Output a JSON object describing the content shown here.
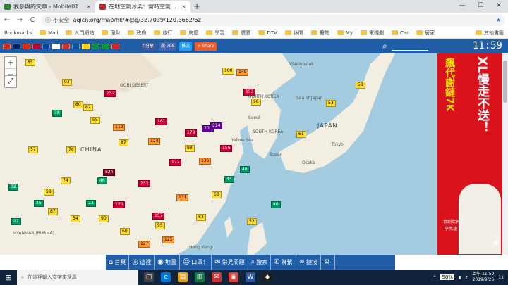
{
  "browser": {
    "tabs": [
      {
        "title": "我參與的文章 - Mobile01",
        "close": "×",
        "favicon_color": "#2e7d32"
      },
      {
        "title": "在地空氣污染：實時空氣質量指數",
        "close": "×",
        "favicon_color": "#c62828"
      }
    ],
    "new_tab": "+",
    "window_controls": [
      "—",
      "☐",
      "✕"
    ],
    "nav": {
      "back": "←",
      "forward": "→",
      "reload": "C"
    },
    "address": {
      "security": "ⓘ 不安全",
      "url": "aqicn.org/map/hk/#@g/32.7039/120.3662/5z",
      "star": "★"
    },
    "bookmarks": [
      "Bookmarks",
      "Mail",
      "入門網站",
      "理財",
      "政府",
      "旅行",
      "房屋",
      "學習",
      "寶寶",
      "DTV",
      "休閒",
      "醫院",
      "My",
      "電視劇",
      "Car",
      "居家"
    ],
    "other_bookmarks": "其他書籤"
  },
  "site": {
    "flag_colors": [
      "#d52b1e",
      "#012169",
      "#de2910",
      "#bc002d",
      "#0047a0",
      "#ffffff",
      "#d52b1e",
      "#0055a4",
      "#ffce00",
      "#009246",
      "#009c3b",
      "#da251d"
    ],
    "share_buttons": [
      {
        "label": "f 分享",
        "color": "#3b5998"
      },
      {
        "label": "讚 708",
        "color": "#4267b2"
      },
      {
        "label": "推文",
        "color": "#1da1f2"
      },
      {
        "label": "+ Share",
        "color": "#f05a28"
      }
    ],
    "search_icon": "⌕",
    "clock": "11:59"
  },
  "map": {
    "zoom_in": "+",
    "zoom_out": "−",
    "fullscreen": "⤢",
    "labels": [
      {
        "text": "GOBI DESERT"
      },
      {
        "text": "CHINA"
      },
      {
        "text": "NORTH KOREA"
      },
      {
        "text": "SOUTH KOREA"
      },
      {
        "text": "JAPAN"
      },
      {
        "text": "MYANMAR (BURMA)"
      },
      {
        "text": "Hong Kong"
      },
      {
        "text": "Yellow Sea"
      },
      {
        "text": "Vladivostok"
      },
      {
        "text": "Sea of Japan"
      },
      {
        "text": "Tokyo"
      },
      {
        "text": "Seoul"
      },
      {
        "text": "Osaka"
      },
      {
        "text": "Busan"
      }
    ],
    "markers": [
      {
        "v": "85",
        "c": "#ffde33"
      },
      {
        "v": "93",
        "c": "#ffde33"
      },
      {
        "v": "152",
        "c": "#cc0033",
        "dark": true
      },
      {
        "v": "100",
        "c": "#ffde33"
      },
      {
        "v": "149",
        "c": "#ff9933"
      },
      {
        "v": "153",
        "c": "#cc0033",
        "dark": true
      },
      {
        "v": "119",
        "c": "#ff9933"
      },
      {
        "v": "80",
        "c": "#ffde33"
      },
      {
        "v": "82",
        "c": "#ffde33"
      },
      {
        "v": "201",
        "c": "#660099",
        "dark": true
      },
      {
        "v": "214",
        "c": "#660099",
        "dark": true
      },
      {
        "v": "78",
        "c": "#ffde33"
      },
      {
        "v": "57",
        "c": "#ffde33"
      },
      {
        "v": "38",
        "c": "#009966",
        "dark": true
      },
      {
        "v": "55",
        "c": "#ffde33"
      },
      {
        "v": "161",
        "c": "#cc0033",
        "dark": true
      },
      {
        "v": "124",
        "c": "#ff9933"
      },
      {
        "v": "87",
        "c": "#ffde33"
      },
      {
        "v": "98",
        "c": "#ffde33"
      },
      {
        "v": "135",
        "c": "#ff9933"
      },
      {
        "v": "172",
        "c": "#cc0033",
        "dark": true
      },
      {
        "v": "179",
        "c": "#cc0033",
        "dark": true
      },
      {
        "v": "156",
        "c": "#cc0033",
        "dark": true
      },
      {
        "v": "61",
        "c": "#ffde33"
      },
      {
        "v": "46",
        "c": "#009966",
        "dark": true
      },
      {
        "v": "74",
        "c": "#ffde33"
      },
      {
        "v": "58",
        "c": "#ffde33"
      },
      {
        "v": "32",
        "c": "#009966",
        "dark": true
      },
      {
        "v": "25",
        "c": "#009966",
        "dark": true
      },
      {
        "v": "87",
        "c": "#ffde33"
      },
      {
        "v": "150",
        "c": "#cc0033",
        "dark": true
      },
      {
        "v": "90",
        "c": "#ffde33"
      },
      {
        "v": "152",
        "c": "#cc0033",
        "dark": true
      },
      {
        "v": "824",
        "c": "#7e0023",
        "dark": true
      },
      {
        "v": "131",
        "c": "#ff9933"
      },
      {
        "v": "95",
        "c": "#ffde33"
      },
      {
        "v": "68",
        "c": "#ffde33"
      },
      {
        "v": "44",
        "c": "#009966",
        "dark": true
      },
      {
        "v": "53",
        "c": "#ffde33"
      },
      {
        "v": "40",
        "c": "#009966",
        "dark": true
      },
      {
        "v": "22",
        "c": "#009966",
        "dark": true
      },
      {
        "v": "54",
        "c": "#ffde33"
      },
      {
        "v": "23",
        "c": "#009966",
        "dark": true
      },
      {
        "v": "60",
        "c": "#ffde33"
      },
      {
        "v": "46",
        "c": "#009966",
        "dark": true
      },
      {
        "v": "53",
        "c": "#ffde33"
      },
      {
        "v": "127",
        "c": "#ff9933"
      },
      {
        "v": "157",
        "c": "#cc0033",
        "dark": true
      },
      {
        "v": "63",
        "c": "#ffde33"
      },
      {
        "v": "125",
        "c": "#ff9933"
      },
      {
        "v": "98",
        "c": "#ffde33"
      },
      {
        "v": "58",
        "c": "#ffde33"
      }
    ]
  },
  "ad": {
    "line1": "XL慢走不送！",
    "line2": "飆代謝鏈7K",
    "caption1": "台創女神",
    "caption2": "李亮瑾",
    "star_icon": "★"
  },
  "bottom_nav": [
    {
      "icon": "⌂",
      "label": "首頁"
    },
    {
      "icon": "◎",
      "label": "這裡"
    },
    {
      "icon": "◉",
      "label": "地圖"
    },
    {
      "icon": "☺",
      "label": "口罩！"
    },
    {
      "icon": "✉",
      "label": "常見問題"
    },
    {
      "icon": "⌕",
      "label": "搜索"
    },
    {
      "icon": "✆",
      "label": "聯繫"
    },
    {
      "icon": "∞",
      "label": "鏈接"
    },
    {
      "icon": "⚙",
      "label": ""
    }
  ],
  "taskbar": {
    "start": "⊞",
    "search_placeholder": "在這裡輸入文字來搜尋",
    "battery": "58%",
    "time": "上午 11:59",
    "date": "2019/9/25",
    "notif_count": "11"
  }
}
